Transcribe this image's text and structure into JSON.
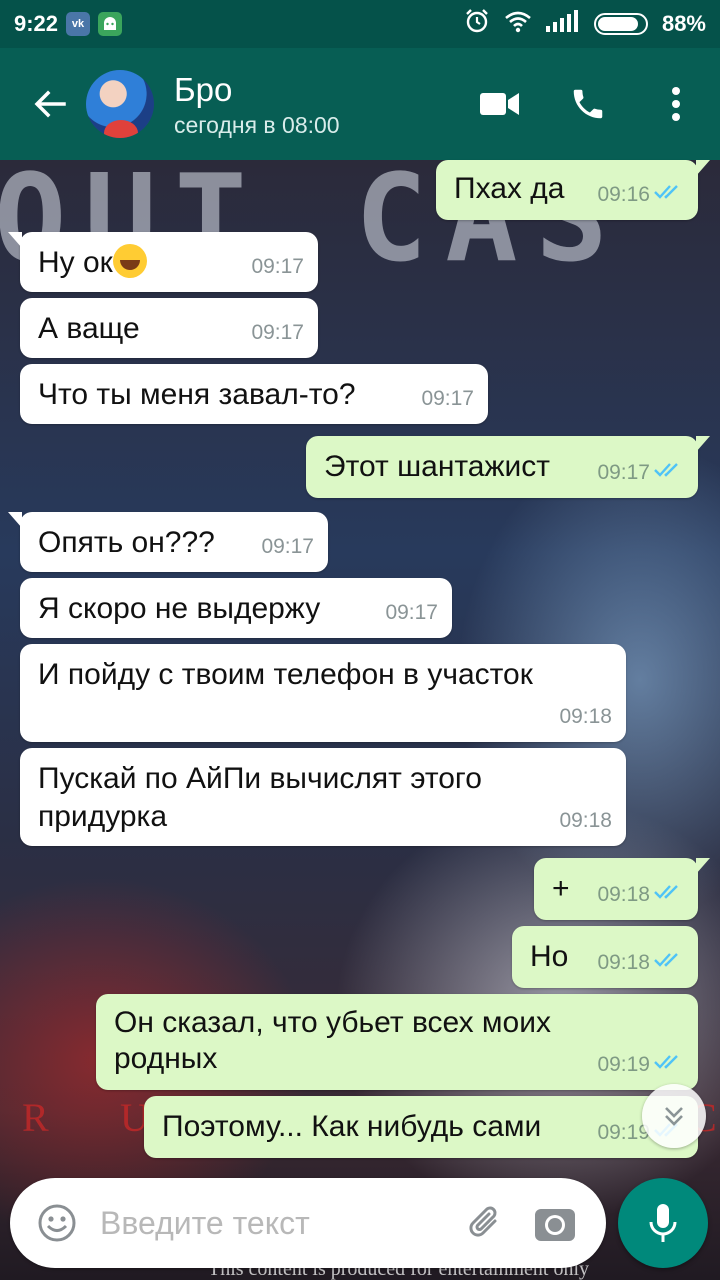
{
  "status_bar": {
    "time": "9:22",
    "app_icons": [
      "vk-icon",
      "android-icon"
    ],
    "battery_percent_label": "88%",
    "battery_level": 0.88,
    "icons": [
      "alarm-icon",
      "wifi-icon",
      "signal-icon",
      "battery-icon"
    ]
  },
  "header": {
    "contact_name": "Бро",
    "contact_status": "сегодня в 08:00",
    "actions": [
      "video-call-icon",
      "voice-call-icon",
      "more-options-icon"
    ]
  },
  "messages": [
    {
      "dir": "out",
      "text": "Пхах да",
      "time": "09:16",
      "read": true
    },
    {
      "dir": "in",
      "text": "Ну ок",
      "emoji": "joy-emoji-icon",
      "time": "09:17"
    },
    {
      "dir": "in",
      "text": "А ваще",
      "time": "09:17"
    },
    {
      "dir": "in",
      "text": "Что ты меня завал-то?",
      "time": "09:17"
    },
    {
      "dir": "out",
      "text": "Этот шантажист",
      "time": "09:17",
      "read": true
    },
    {
      "dir": "in",
      "text": "Опять он???",
      "time": "09:17"
    },
    {
      "dir": "in",
      "text": "Я скоро не выдержу",
      "time": "09:17"
    },
    {
      "dir": "in",
      "text": "И пойду с твоим телефон в участок",
      "time": "09:18"
    },
    {
      "dir": "in",
      "text_lines": [
        "Пускай по АйПи вычислят этого",
        "придурка"
      ],
      "time": "09:18"
    },
    {
      "dir": "out",
      "text": "+",
      "time": "09:18",
      "read": true
    },
    {
      "dir": "out",
      "text": "Но",
      "time": "09:18",
      "read": true
    },
    {
      "dir": "out",
      "text_lines": [
        "Он сказал, что убьет всех моих",
        "родных"
      ],
      "time": "09:19",
      "read": true
    },
    {
      "dir": "out",
      "text": "Поэтому... Как нибудь сами",
      "time": "09:19",
      "read": true
    }
  ],
  "wallpaper": {
    "title_fragment": "OUT CAS",
    "letters": [
      "R",
      "U",
      "C"
    ],
    "caption": "This content is produced for entertainment only"
  },
  "input": {
    "placeholder": "Введите текст",
    "value": ""
  },
  "colors": {
    "header": "#075e54",
    "status_bar": "#05524a",
    "outgoing_bubble": "#dcf8c6",
    "incoming_bubble": "#ffffff",
    "read_ticks": "#4fc3f7",
    "mic_button": "#00897b"
  }
}
